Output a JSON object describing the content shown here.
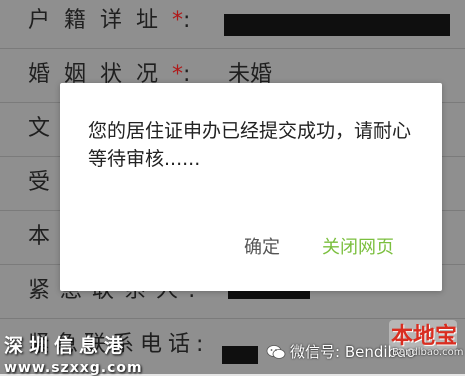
{
  "form": {
    "rows": [
      {
        "label": "户籍详址",
        "required": true,
        "value": "",
        "redacted": true
      },
      {
        "label": "婚姻状况",
        "required": true,
        "value": "未婚",
        "redacted": false
      },
      {
        "label": "文",
        "required": false,
        "value": "",
        "redacted": false
      },
      {
        "label": "受",
        "required": false,
        "value": "",
        "redacted": false
      },
      {
        "label": "本人",
        "required": false,
        "value": "",
        "redacted": false
      },
      {
        "label": "紧急联系人:",
        "required": false,
        "value": "",
        "redacted": true
      },
      {
        "label": "紧急联系电话:",
        "required": false,
        "value": "",
        "redacted": true
      }
    ],
    "required_mark": "*",
    "colon": ":"
  },
  "modal": {
    "message": "您的居住证申办已经提交成功，请耐心等待审核......",
    "confirm_label": "确定",
    "close_label": "关闭网页",
    "close_color": "#7bbf3e"
  },
  "watermarks": {
    "left_title": "深圳信息港",
    "left_url": "www.szxxg.com",
    "right_wechat": "微信号: Bendibao",
    "logo_text": "本地宝",
    "logo_url": "Bendibao.com"
  }
}
